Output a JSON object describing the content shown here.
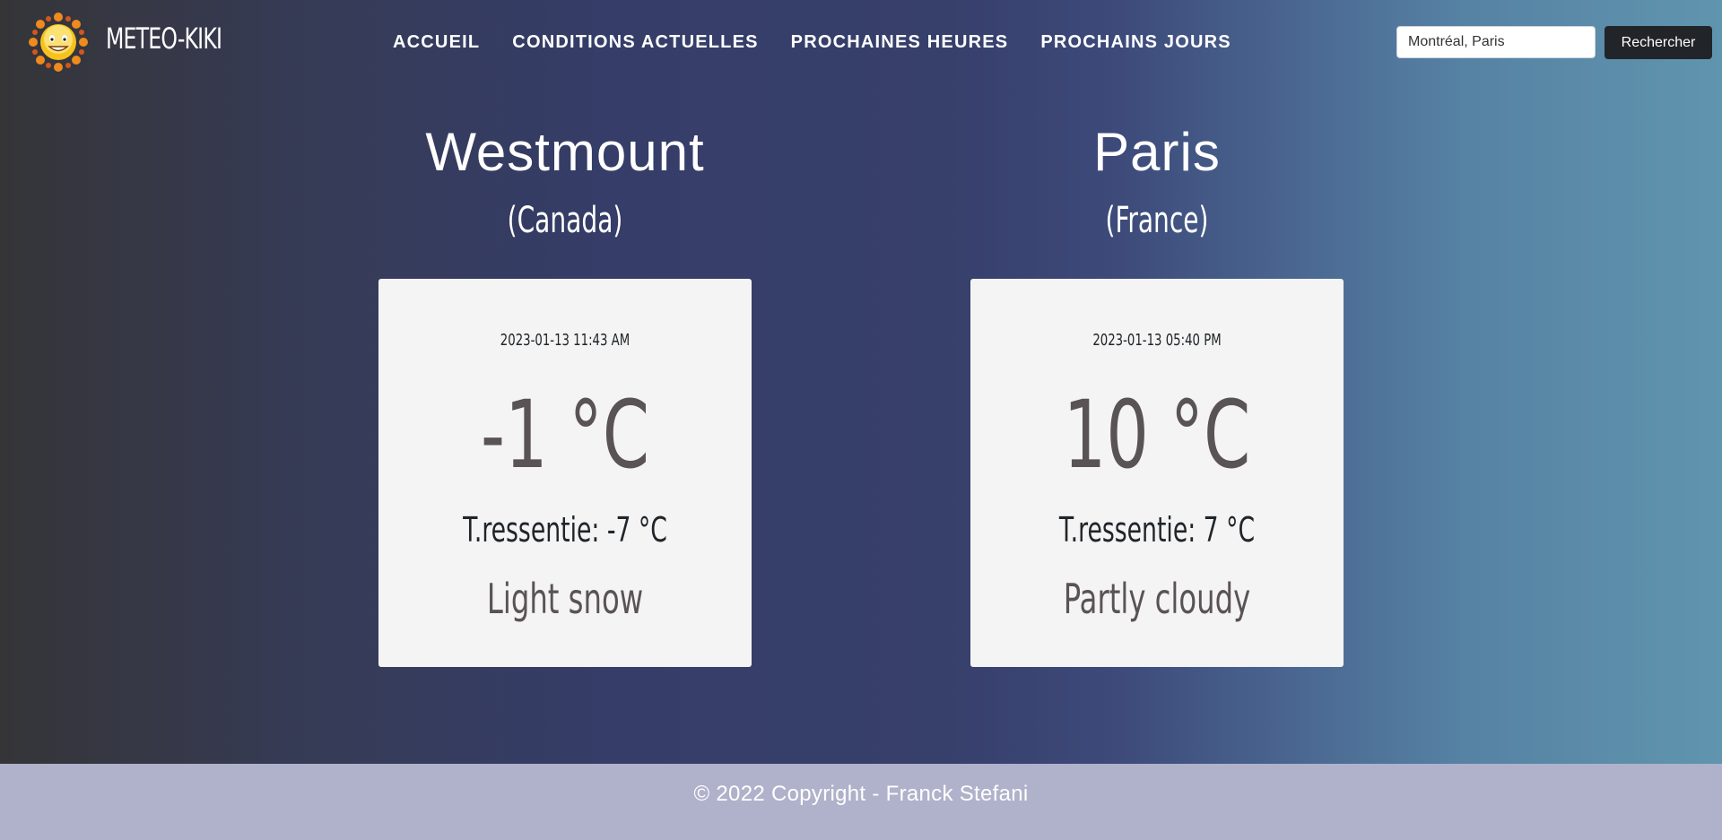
{
  "header": {
    "brand": "METEO-KIKI",
    "logo_icon": "sun-mascot-icon",
    "nav": [
      {
        "label": "ACCUEIL"
      },
      {
        "label": "CONDITIONS ACTUELLES"
      },
      {
        "label": "PROCHAINES HEURES"
      },
      {
        "label": "PROCHAINS JOURS"
      }
    ],
    "search": {
      "value": "Montréal, Paris",
      "button_label": "Rechercher"
    }
  },
  "cities": [
    {
      "name": "Westmount",
      "country": "(Canada)",
      "datetime": "2023-01-13 11:43 AM",
      "temperature": "-1 °C",
      "feels_like": "T.ressentie: -7 °C",
      "condition": "Light snow"
    },
    {
      "name": "Paris",
      "country": "(France)",
      "datetime": "2023-01-13 05:40 PM",
      "temperature": "10 °C",
      "feels_like": "T.ressentie: 7 °C",
      "condition": "Partly cloudy"
    }
  ],
  "footer": {
    "text": "© 2022 Copyright - Franck Stefani"
  },
  "colors": {
    "card_bg": "#f4f4f4",
    "footer_bg": "#b0b2cb",
    "button_bg": "#212529"
  }
}
